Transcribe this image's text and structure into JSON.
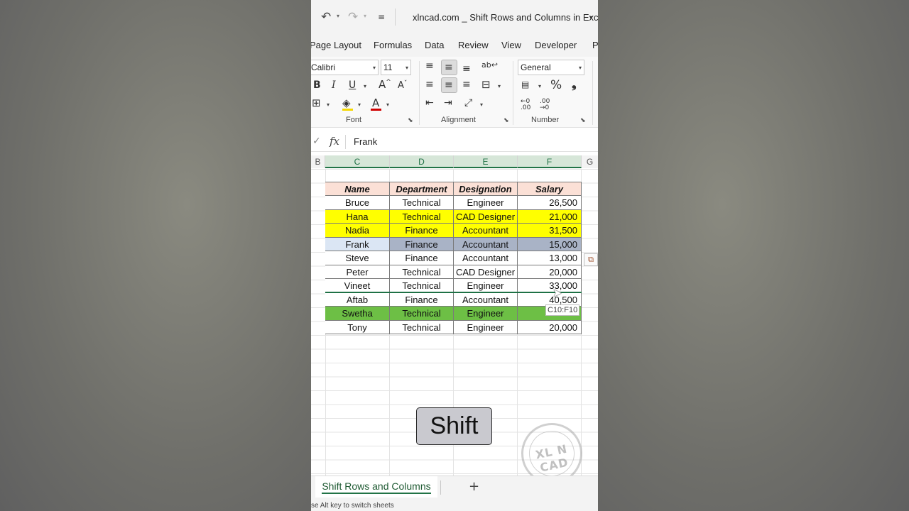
{
  "titlebar": {
    "undo_icon": "undo-icon",
    "redo_icon": "redo-icon",
    "customize_icon": "customize-quick-access-icon",
    "document_title": "xlncad.com _ Shift Rows and Columns in Excel"
  },
  "ribbon_tabs": [
    "Page Layout",
    "Formulas",
    "Data",
    "Review",
    "View",
    "Developer",
    "P"
  ],
  "font_group": {
    "font_name": "Calibri",
    "font_size": "11",
    "label": "Font",
    "bold": "B",
    "italic": "I",
    "underline": "U",
    "grow_font": "A",
    "shrink_font": "A",
    "font_color_letter": "A",
    "font_color": "#d00000",
    "fill_color": "#f5d800"
  },
  "alignment_group": {
    "label": "Alignment"
  },
  "number_group": {
    "label": "Number",
    "format": "General",
    "percent": "%",
    "comma": "❩",
    "increase_decimal": "←.0 .00",
    "decrease_decimal": ".00 →.0"
  },
  "formula_bar": {
    "fx_label": "fx",
    "value": "Frank"
  },
  "columns": [
    "B",
    "C",
    "D",
    "E",
    "F",
    "G"
  ],
  "table": {
    "headers": [
      "Name",
      "Department",
      "Designation",
      "Salary"
    ],
    "rows": [
      {
        "name": "Bruce",
        "department": "Technical",
        "designation": "Engineer",
        "salary": "26,500",
        "fill": "#ffffff"
      },
      {
        "name": "Hana",
        "department": "Technical",
        "designation": "CAD Designer",
        "salary": "21,000",
        "fill": "#ffff00"
      },
      {
        "name": "Nadia",
        "department": "Finance",
        "designation": "Accountant",
        "salary": "31,500",
        "fill": "#ffff00"
      },
      {
        "name": "Frank",
        "department": "Finance",
        "designation": "Accountant",
        "salary": "15,000",
        "fill": "#a9b3c6"
      },
      {
        "name": "Steve",
        "department": "Finance",
        "designation": "Accountant",
        "salary": "13,000",
        "fill": "#ffffff"
      },
      {
        "name": "Peter",
        "department": "Technical",
        "designation": "CAD Designer",
        "salary": "20,000",
        "fill": "#ffffff"
      },
      {
        "name": "Vineet",
        "department": "Technical",
        "designation": "Engineer",
        "salary": "33,000",
        "fill": "#ffffff"
      },
      {
        "name": "Aftab",
        "department": "Finance",
        "designation": "Accountant",
        "salary": "40,500",
        "fill": "#ffffff"
      },
      {
        "name": "Swetha",
        "department": "Technical",
        "designation": "Engineer",
        "salary": "",
        "fill": "#6dbf45"
      },
      {
        "name": "Tony",
        "department": "Technical",
        "designation": "Engineer",
        "salary": "20,000",
        "fill": "#ffffff"
      }
    ],
    "header_fill": "#fbe0d6"
  },
  "drag_tooltip": "C10:F10",
  "keycap_label": "Shift",
  "watermark": "XL N CAD",
  "sheet_tab": "Shift Rows and Columns",
  "add_sheet": "+",
  "status_text": "se Alt key to switch sheets"
}
